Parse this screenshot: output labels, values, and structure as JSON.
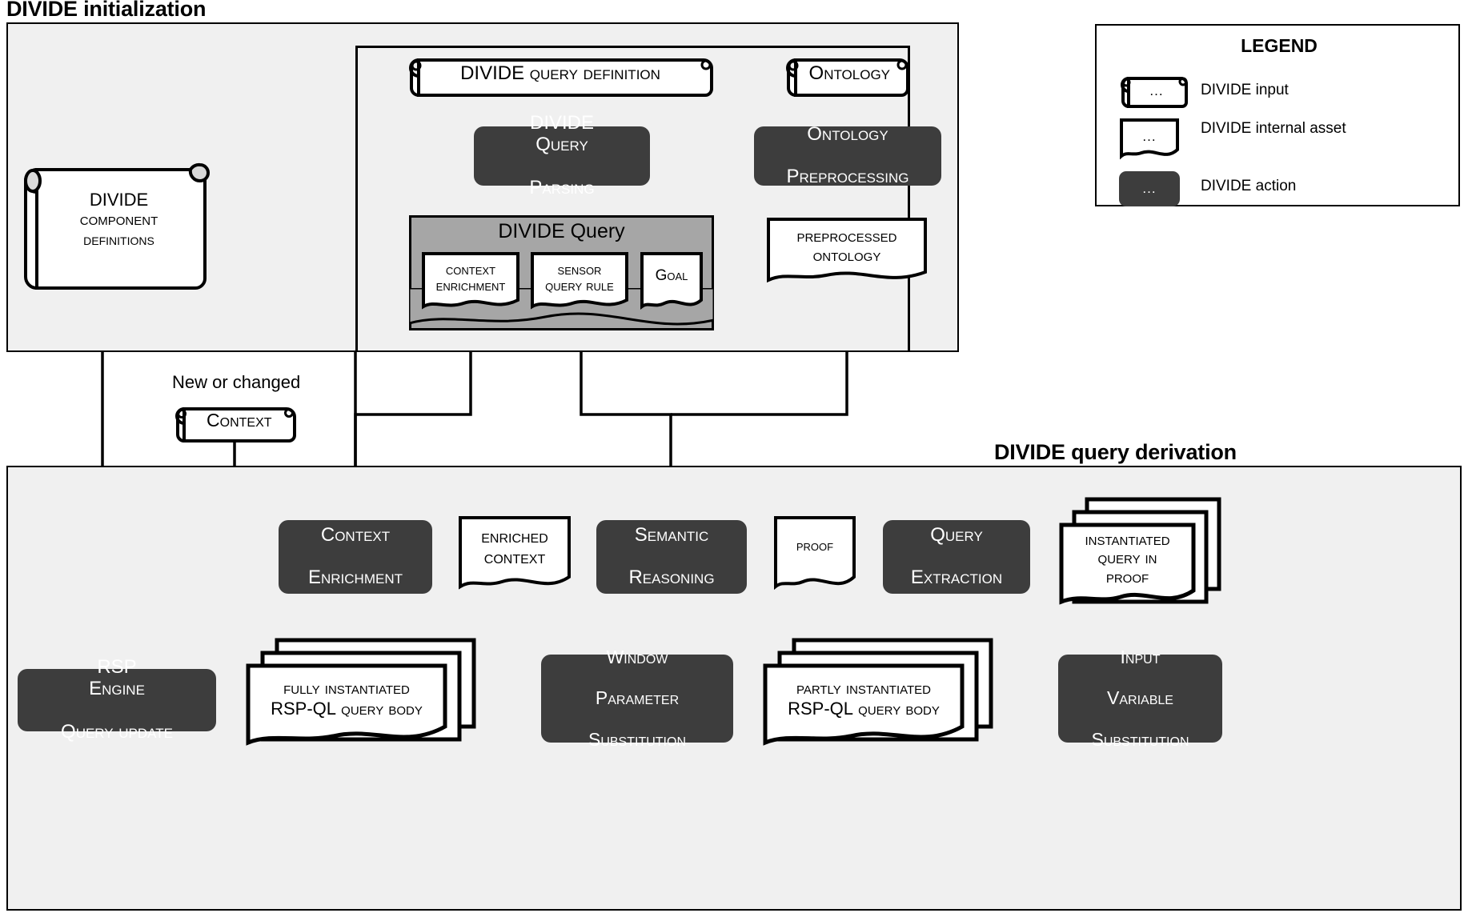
{
  "sections": {
    "init": {
      "title": "DIVIDE initialization"
    },
    "derivation": {
      "title": "DIVIDE query derivation"
    }
  },
  "legend": {
    "title": "LEGEND",
    "ellipsis": "...",
    "items": [
      {
        "shape": "scroll",
        "label": "DIVIDE input"
      },
      {
        "shape": "document",
        "label": "DIVIDE internal asset"
      },
      {
        "shape": "action",
        "label": "DIVIDE action"
      }
    ]
  },
  "nodes": {
    "component_definitions": {
      "l1": "DIVIDE",
      "l2": "Component",
      "l3": "definitions"
    },
    "query_definition": {
      "l1": "DIVIDE",
      "l2": "query definition"
    },
    "ontology": {
      "l1": "Ontology"
    },
    "query_parsing": {
      "l1": "DIVIDE Query",
      "l2": "Parsing"
    },
    "ontology_preprocessing": {
      "l1": "Ontology",
      "l2": "Preprocessing"
    },
    "divide_query": {
      "title": "DIVIDE Query"
    },
    "context_enrichment_rule": {
      "l1": "Context",
      "l2": "Enrichment"
    },
    "sensor_query_rule": {
      "l1": "Sensor",
      "l2": "Query Rule"
    },
    "goal": {
      "l1": "Goal"
    },
    "preprocessed_ontology": {
      "l1": "Preprocessed",
      "l2": "ontology"
    },
    "new_or_changed": {
      "caption": "New or changed"
    },
    "context": {
      "l1": "Context"
    },
    "context_enrichment": {
      "l1": "Context",
      "l2": "Enrichment"
    },
    "enriched_context": {
      "l1": "Enriched",
      "l2": "Context"
    },
    "semantic_reasoning": {
      "l1": "Semantic",
      "l2": "Reasoning"
    },
    "proof": {
      "l1": "proof"
    },
    "query_extraction": {
      "l1": "Query",
      "l2": "Extraction"
    },
    "instantiated_query_in_proof": {
      "l1": "Instantiated",
      "l2": "query in",
      "l3": "proof"
    },
    "input_variable_substitution": {
      "l1": "Input",
      "l2": "Variable",
      "l3": "Substitution"
    },
    "partly_instantiated": {
      "l1": "Partly Instantiated",
      "l2": "RSP-QL query body"
    },
    "window_parameter_substitution": {
      "l1": "Window",
      "l2": "Parameter",
      "l3": "Substitution"
    },
    "fully_instantiated": {
      "l1": "Fully Instantiated",
      "l2": "RSP-QL query body"
    },
    "rsp_engine_query_update": {
      "l1": "RSP Engine",
      "l2": "Query Update"
    }
  },
  "colors": {
    "action_fill": "#3d3d3d",
    "panel_fill": "#f0f0f0",
    "gray_container": "#a6a6a6",
    "stroke": "#000000",
    "page_bg": "#ffffff"
  }
}
